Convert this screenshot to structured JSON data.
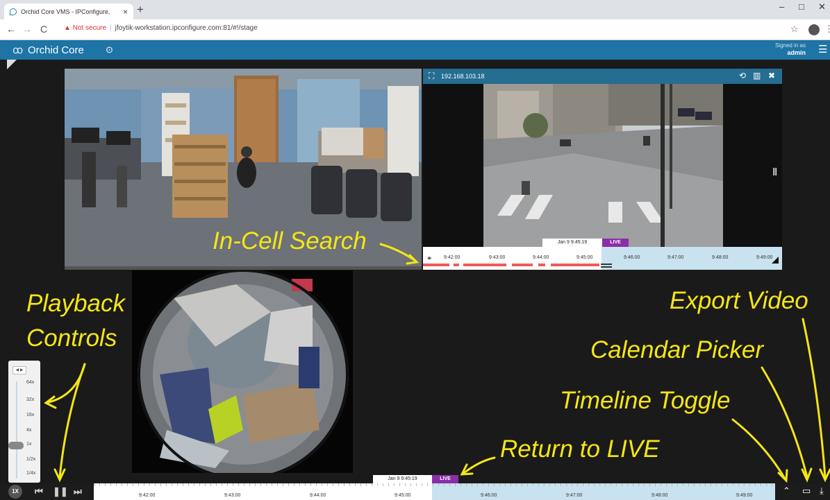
{
  "browser": {
    "tab_title": "Orchid Core VMS - IPConfigure,",
    "tab_close": "×",
    "new_tab": "+",
    "not_secure": "Not secure",
    "url": "jfoytik-workstation.ipconfigure.com:81/#!/stage",
    "nav_back": "←",
    "nav_forward": "→",
    "nav_reload": "C",
    "star": "☆",
    "more": "⋮",
    "win_min": "–",
    "win_max": "□",
    "win_close": "✕"
  },
  "app": {
    "brand": "Orchid Core",
    "signed_in_label": "Signed in as",
    "user": "admin"
  },
  "cell2": {
    "camera_ip": "192.168.103.18",
    "timestamp": "Jan 9 9:45:19",
    "live_label": "LIVE",
    "ticks": [
      "9:42:00",
      "9:43:00",
      "9:44:00",
      "9:45:00",
      "9:46:00",
      "9:47:00",
      "9:48:00",
      "9:49:00"
    ]
  },
  "speed": {
    "labels": [
      "64x",
      "32x",
      "16x",
      "4x",
      "1x",
      "1/2x",
      "1/4x"
    ],
    "current": "1x"
  },
  "bottom": {
    "speed_badge": "1X",
    "timestamp": "Jan 9 9:45:19",
    "live_label": "LIVE",
    "ticks": [
      "9:42:00",
      "9:43:00",
      "9:44:00",
      "9:45:00",
      "9:46:00",
      "9:47:00",
      "9:48:00",
      "9:49:00"
    ]
  },
  "annotations": {
    "in_cell_search": "In-Cell Search",
    "playback_line1": "Playback",
    "playback_line2": "Controls",
    "export_video": "Export Video",
    "calendar_picker": "Calendar Picker",
    "timeline_toggle": "Timeline Toggle",
    "return_live": "Return to LIVE"
  },
  "colors": {
    "header_blue": "#1e74a5",
    "live_purple": "#8a2fa8",
    "annotation_yellow": "#f5e614",
    "recording_red": "#f05a5a",
    "future_blue": "#c8e2ef"
  },
  "icons": [
    "orchid-logo-icon",
    "dashboard-icon",
    "hamburger-menu-icon",
    "fullscreen-icon",
    "search-icon",
    "stats-icon",
    "close-icon",
    "pause-icon",
    "skip-back-icon",
    "play-pause-icon",
    "skip-forward-icon",
    "chevron-up-icon",
    "calendar-icon",
    "download-icon"
  ]
}
